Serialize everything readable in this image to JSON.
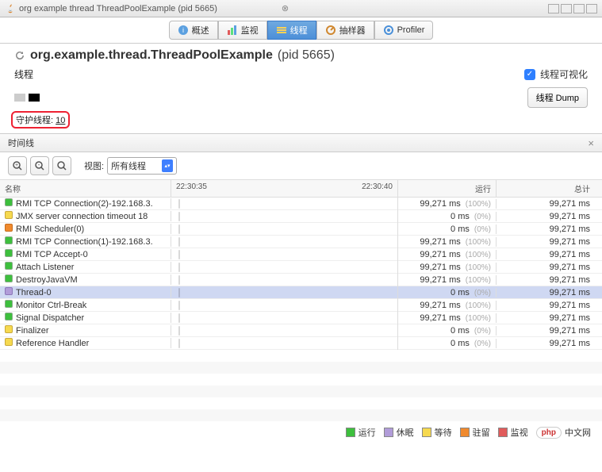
{
  "window": {
    "tab_title": "org example thread ThreadPoolExample (pid 5665)"
  },
  "tabs": {
    "overview": "概述",
    "monitor": "监视",
    "threads": "线程",
    "sampler": "抽样器",
    "profiler": "Profiler"
  },
  "header": {
    "title": "org.example.thread.ThreadPoolExample",
    "pid": "(pid 5665)"
  },
  "subheader": {
    "label": "线程",
    "vis_label": "线程可视化",
    "vis_checked": true
  },
  "daemon": {
    "label": "守护线程:",
    "count": "10"
  },
  "dump_button": "线程 Dump",
  "timeline": {
    "label": "时间线"
  },
  "toolbar": {
    "view_label": "视图:",
    "select_value": "所有线程"
  },
  "table": {
    "col_name": "名称",
    "time1": "22:30:35",
    "time2": "22:30:40",
    "col_run": "运行",
    "col_total": "总计",
    "rows": [
      {
        "name": "RMI TCP Connection(2)-192.168.3.",
        "color": "green",
        "run": "99,271 ms",
        "pct": "(100%)",
        "total": "99,271 ms"
      },
      {
        "name": "JMX server connection timeout 18",
        "color": "yellow",
        "run": "0 ms",
        "pct": "(0%)",
        "total": "99,271 ms"
      },
      {
        "name": "RMI Scheduler(0)",
        "color": "orange",
        "run": "0 ms",
        "pct": "(0%)",
        "total": "99,271 ms"
      },
      {
        "name": "RMI TCP Connection(1)-192.168.3.",
        "color": "green",
        "run": "99,271 ms",
        "pct": "(100%)",
        "total": "99,271 ms"
      },
      {
        "name": "RMI TCP Accept-0",
        "color": "green",
        "run": "99,271 ms",
        "pct": "(100%)",
        "total": "99,271 ms"
      },
      {
        "name": "Attach Listener",
        "color": "green",
        "run": "99,271 ms",
        "pct": "(100%)",
        "total": "99,271 ms"
      },
      {
        "name": "DestroyJavaVM",
        "color": "green",
        "run": "99,271 ms",
        "pct": "(100%)",
        "total": "99,271 ms"
      },
      {
        "name": "Thread-0",
        "color": "purple",
        "run": "0 ms",
        "pct": "(0%)",
        "total": "99,271 ms",
        "selected": true
      },
      {
        "name": "Monitor Ctrl-Break",
        "color": "green",
        "run": "99,271 ms",
        "pct": "(100%)",
        "total": "99,271 ms"
      },
      {
        "name": "Signal Dispatcher",
        "color": "green",
        "run": "99,271 ms",
        "pct": "(100%)",
        "total": "99,271 ms"
      },
      {
        "name": "Finalizer",
        "color": "yellow",
        "run": "0 ms",
        "pct": "(0%)",
        "total": "99,271 ms"
      },
      {
        "name": "Reference Handler",
        "color": "yellow",
        "run": "0 ms",
        "pct": "(0%)",
        "total": "99,271 ms"
      }
    ]
  },
  "legend": {
    "running": "运行",
    "sleeping": "休眠",
    "waiting": "等待",
    "parked": "驻留",
    "monitor": "监视"
  },
  "watermark": {
    "php": "php",
    "site": "中文网"
  }
}
